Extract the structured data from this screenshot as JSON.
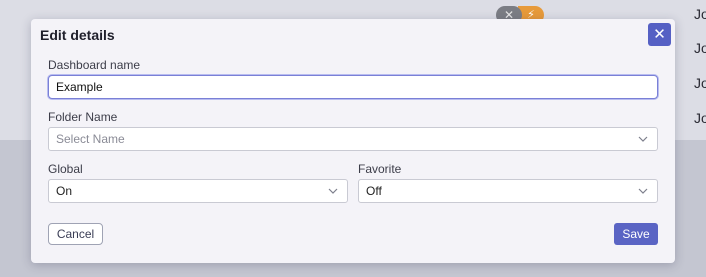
{
  "background": {
    "badge_left": "✕",
    "badge_right": "⚡",
    "names": [
      "Jo",
      "Jo",
      "Jo",
      "Jo"
    ]
  },
  "modal": {
    "title": "Edit details",
    "close_label": "✕",
    "fields": {
      "dashboard_name": {
        "label": "Dashboard name",
        "value": "Example"
      },
      "folder_name": {
        "label": "Folder Name",
        "placeholder": "Select Name"
      },
      "global": {
        "label": "Global",
        "value": "On"
      },
      "favorite": {
        "label": "Favorite",
        "value": "Off"
      }
    },
    "cancel_label": "Cancel",
    "save_label": "Save"
  },
  "colors": {
    "accent": "#5a64c4",
    "overlay_light": "#dcdde5",
    "overlay_dark": "#c4c6d1"
  }
}
